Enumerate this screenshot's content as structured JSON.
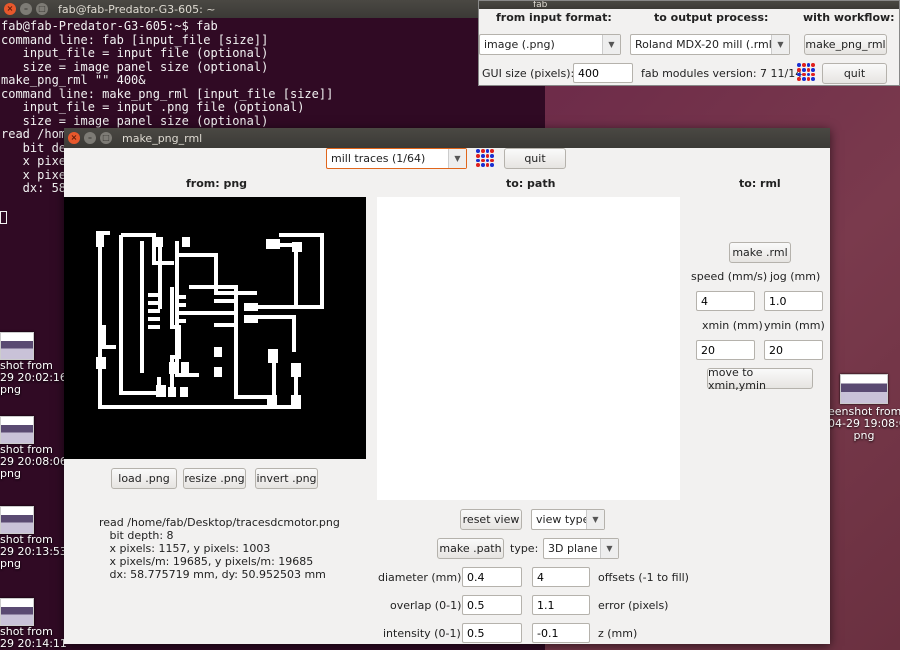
{
  "terminal": {
    "title": "fab@fab-Predator-G3-605: ~",
    "lines": [
      "fab@fab-Predator-G3-605:~$ fab",
      "command line: fab [input_file [size]]",
      "   input_file = input file (optional)",
      "   size = image panel size (optional)",
      "make_png_rml \"\" 400&",
      "command line: make_png_rml [input_file [size]]",
      "   input_file = input .png file (optional)",
      "   size = image panel size (optional)",
      "read /home",
      "   bit dep",
      "   x pixel",
      "   x pixel",
      "   dx: 58."
    ]
  },
  "desktop_left": [
    {
      "label1": "shot from",
      "label2": "29 20:02:16.",
      "label3": "png"
    },
    {
      "label1": "shot from",
      "label2": "29 20:08:06.",
      "label3": "png"
    },
    {
      "label1": "shot from",
      "label2": "29 20:13:53.",
      "label3": "png"
    },
    {
      "label1": "shot from",
      "label2": "29 20:14:11",
      "label3": ""
    }
  ],
  "desktop_right": {
    "label1": "eenshot from",
    "label2": "04-29 19:08:09.",
    "label3": "png"
  },
  "fab": {
    "title": "fab",
    "from_label": "from input format:",
    "to_label": "to output process:",
    "workflow_label": "with workflow:",
    "input_format": "image (.png)",
    "output_process": "Roland MDX-20 mill (.rml)",
    "workflow_button": "make_png_rml",
    "gui_size_label": "GUI size (pixels):",
    "gui_size_value": "400",
    "version_text": "fab modules version: 7  11/14",
    "quit_label": "quit"
  },
  "main": {
    "title": "make_png_rml",
    "mode": "mill traces (1/64)",
    "quit_label": "quit",
    "from_head": "from: png",
    "to_path_head": "to: path",
    "to_rml_head": "to: rml",
    "load_btn": "load .png",
    "resize_btn": "resize .png",
    "invert_btn": "invert .png",
    "info": "read /home/fab/Desktop/tracesdcmotor.png\n   bit depth: 8\n   x pixels: 1157, y pixels: 1003\n   x pixels/m: 19685, y pixels/m: 19685\n   dx: 58.775719 mm, dy: 50.952503 mm",
    "reset_view": "reset view",
    "view_type": "view type",
    "make_path": "make .path",
    "type_label": "type:",
    "type_value": "3D plane",
    "diameter_label": "diameter (mm)",
    "diameter_value": "0.4",
    "offsets_value": "4",
    "offsets_label": "offsets (-1 to fill)",
    "overlap_label": "overlap (0-1)",
    "overlap_value": "0.5",
    "error_value": "1.1",
    "error_label": "error (pixels)",
    "intensity_label": "intensity (0-1)",
    "intensity_value": "0.5",
    "z_value": "-0.1",
    "z_label": "z (mm)",
    "make_rml": "make .rml",
    "speed_label": "speed (mm/s)",
    "speed_value": "4",
    "jog_label": "jog (mm)",
    "jog_value": "1.0",
    "xmin_label": "xmin (mm)",
    "xmin_value": "20",
    "ymin_label": "ymin (mm)",
    "ymin_value": "20",
    "move_btn": "move to xmin,ymin"
  },
  "colors": {
    "logo_blue": "#1a2fd0",
    "logo_red": "#e0201c",
    "terminal_bg": "#300a24"
  }
}
